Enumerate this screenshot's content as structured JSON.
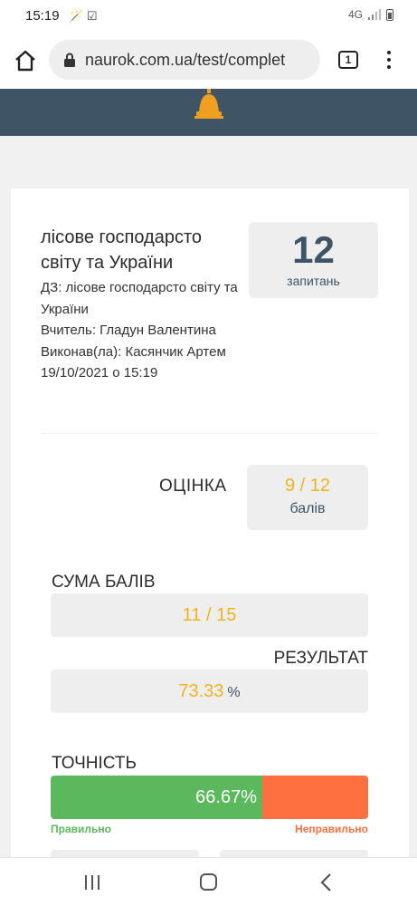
{
  "status_bar": {
    "time": "15:19",
    "left_icons": [
      "magic-wand-icon",
      "check-box-icon"
    ],
    "network": "4G",
    "right_icons": [
      "network-4g-icon",
      "signal-icon",
      "battery-icon"
    ]
  },
  "browser": {
    "url": "naurok.com.ua/test/complet",
    "tab_count": "1"
  },
  "header": {
    "icon": "bell-icon",
    "color": "#3f5465"
  },
  "test": {
    "title": "лісове господарсто світу та України",
    "assignment": "ДЗ: лісове господарсто світу та України",
    "teacher": "Вчитель: Гладун Валентина",
    "performer": "Виконав(ла): Касянчик Артем",
    "datetime": "19/10/2021 о 15:19"
  },
  "questions": {
    "count": "12",
    "label": "запитань"
  },
  "grade": {
    "label": "ОЦІНКА",
    "value": "9 / 12",
    "unit": "балів"
  },
  "score_sum": {
    "label": "СУМА БАЛІВ",
    "value": "11 / 15"
  },
  "result": {
    "label": "РЕЗУЛЬТАТ",
    "value": "73.33",
    "unit": "%"
  },
  "accuracy": {
    "label": "ТОЧНІСТЬ",
    "correct_percent": 66.67,
    "correct_text": "66.67%",
    "correct_legend": "Правильно",
    "wrong_legend": "Неправильно",
    "correct_color": "#5cb85c",
    "wrong_color": "#ff7040"
  },
  "accent_color": "#f0b31e"
}
